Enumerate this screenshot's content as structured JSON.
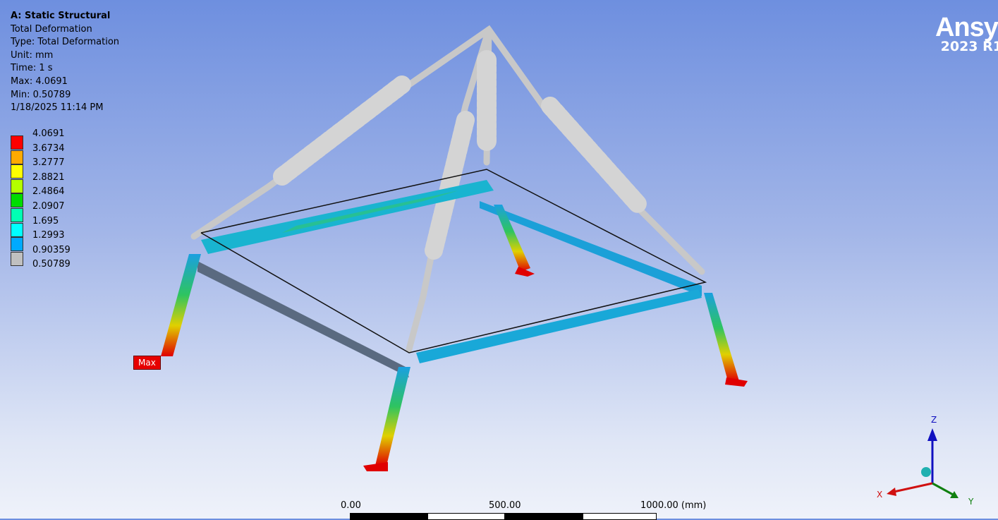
{
  "info": {
    "title": "A: Static Structural",
    "result": "Total Deformation",
    "type": "Type: Total Deformation",
    "unit": "Unit: mm",
    "time": "Time: 1 s",
    "max": "Max: 4.0691",
    "min": "Min: 0.50789",
    "date": "1/18/2025 11:14 PM"
  },
  "legend": {
    "labels": [
      "4.0691",
      "3.6734",
      "3.2777",
      "2.8821",
      "2.4864",
      "2.0907",
      "1.695",
      "1.2993",
      "0.90359",
      "0.50789"
    ],
    "colors": [
      "#ff0000",
      "#ffaa00",
      "#ffff00",
      "#b4ff00",
      "#00dc00",
      "#00ffb4",
      "#00ffff",
      "#00aaff",
      "#c0c0c0"
    ]
  },
  "logo": {
    "name": "Ansys",
    "version": "2023 R1"
  },
  "scale": {
    "l0": "0.00",
    "l1": "500.00",
    "l2": "1000.00 (mm)"
  },
  "probe": {
    "max_label": "Max"
  },
  "triad": {
    "x": "X",
    "y": "Y",
    "z": "Z"
  }
}
